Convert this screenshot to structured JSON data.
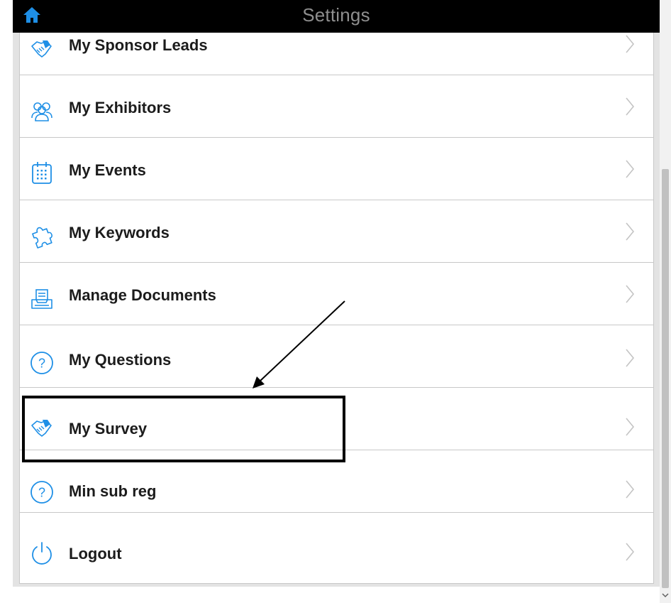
{
  "header": {
    "title": "Settings",
    "home_icon": "home-icon"
  },
  "colors": {
    "header_bg": "#000000",
    "header_text": "#8e8e8e",
    "icon_blue": "#1e8fe6",
    "label_text": "#1c1c1c",
    "divider": "#c8c8c8"
  },
  "menu": [
    {
      "label": "My Sponsor Leads",
      "icon": "handshake-icon"
    },
    {
      "label": "My Exhibitors",
      "icon": "people-group-icon"
    },
    {
      "label": "My Events",
      "icon": "calendar-icon"
    },
    {
      "label": "My Keywords",
      "icon": "puzzle-icon"
    },
    {
      "label": "Manage Documents",
      "icon": "document-tray-icon"
    },
    {
      "label": "My Questions",
      "icon": "question-circle-icon"
    },
    {
      "label": "My Survey",
      "icon": "handshake-icon",
      "highlighted": true
    },
    {
      "label": "Min sub reg",
      "icon": "question-circle-icon"
    },
    {
      "label": "Logout",
      "icon": "power-icon"
    }
  ]
}
